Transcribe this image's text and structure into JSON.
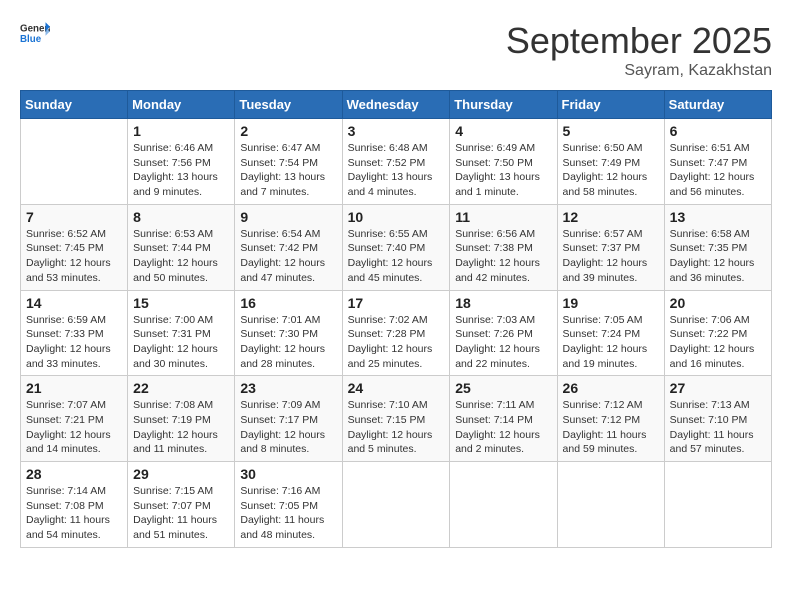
{
  "header": {
    "logo_general": "General",
    "logo_blue": "Blue",
    "month_title": "September 2025",
    "location": "Sayram, Kazakhstan"
  },
  "weekdays": [
    "Sunday",
    "Monday",
    "Tuesday",
    "Wednesday",
    "Thursday",
    "Friday",
    "Saturday"
  ],
  "weeks": [
    [
      {
        "day": "",
        "sunrise": "",
        "sunset": "",
        "daylight": ""
      },
      {
        "day": "1",
        "sunrise": "Sunrise: 6:46 AM",
        "sunset": "Sunset: 7:56 PM",
        "daylight": "Daylight: 13 hours and 9 minutes."
      },
      {
        "day": "2",
        "sunrise": "Sunrise: 6:47 AM",
        "sunset": "Sunset: 7:54 PM",
        "daylight": "Daylight: 13 hours and 7 minutes."
      },
      {
        "day": "3",
        "sunrise": "Sunrise: 6:48 AM",
        "sunset": "Sunset: 7:52 PM",
        "daylight": "Daylight: 13 hours and 4 minutes."
      },
      {
        "day": "4",
        "sunrise": "Sunrise: 6:49 AM",
        "sunset": "Sunset: 7:50 PM",
        "daylight": "Daylight: 13 hours and 1 minute."
      },
      {
        "day": "5",
        "sunrise": "Sunrise: 6:50 AM",
        "sunset": "Sunset: 7:49 PM",
        "daylight": "Daylight: 12 hours and 58 minutes."
      },
      {
        "day": "6",
        "sunrise": "Sunrise: 6:51 AM",
        "sunset": "Sunset: 7:47 PM",
        "daylight": "Daylight: 12 hours and 56 minutes."
      }
    ],
    [
      {
        "day": "7",
        "sunrise": "Sunrise: 6:52 AM",
        "sunset": "Sunset: 7:45 PM",
        "daylight": "Daylight: 12 hours and 53 minutes."
      },
      {
        "day": "8",
        "sunrise": "Sunrise: 6:53 AM",
        "sunset": "Sunset: 7:44 PM",
        "daylight": "Daylight: 12 hours and 50 minutes."
      },
      {
        "day": "9",
        "sunrise": "Sunrise: 6:54 AM",
        "sunset": "Sunset: 7:42 PM",
        "daylight": "Daylight: 12 hours and 47 minutes."
      },
      {
        "day": "10",
        "sunrise": "Sunrise: 6:55 AM",
        "sunset": "Sunset: 7:40 PM",
        "daylight": "Daylight: 12 hours and 45 minutes."
      },
      {
        "day": "11",
        "sunrise": "Sunrise: 6:56 AM",
        "sunset": "Sunset: 7:38 PM",
        "daylight": "Daylight: 12 hours and 42 minutes."
      },
      {
        "day": "12",
        "sunrise": "Sunrise: 6:57 AM",
        "sunset": "Sunset: 7:37 PM",
        "daylight": "Daylight: 12 hours and 39 minutes."
      },
      {
        "day": "13",
        "sunrise": "Sunrise: 6:58 AM",
        "sunset": "Sunset: 7:35 PM",
        "daylight": "Daylight: 12 hours and 36 minutes."
      }
    ],
    [
      {
        "day": "14",
        "sunrise": "Sunrise: 6:59 AM",
        "sunset": "Sunset: 7:33 PM",
        "daylight": "Daylight: 12 hours and 33 minutes."
      },
      {
        "day": "15",
        "sunrise": "Sunrise: 7:00 AM",
        "sunset": "Sunset: 7:31 PM",
        "daylight": "Daylight: 12 hours and 30 minutes."
      },
      {
        "day": "16",
        "sunrise": "Sunrise: 7:01 AM",
        "sunset": "Sunset: 7:30 PM",
        "daylight": "Daylight: 12 hours and 28 minutes."
      },
      {
        "day": "17",
        "sunrise": "Sunrise: 7:02 AM",
        "sunset": "Sunset: 7:28 PM",
        "daylight": "Daylight: 12 hours and 25 minutes."
      },
      {
        "day": "18",
        "sunrise": "Sunrise: 7:03 AM",
        "sunset": "Sunset: 7:26 PM",
        "daylight": "Daylight: 12 hours and 22 minutes."
      },
      {
        "day": "19",
        "sunrise": "Sunrise: 7:05 AM",
        "sunset": "Sunset: 7:24 PM",
        "daylight": "Daylight: 12 hours and 19 minutes."
      },
      {
        "day": "20",
        "sunrise": "Sunrise: 7:06 AM",
        "sunset": "Sunset: 7:22 PM",
        "daylight": "Daylight: 12 hours and 16 minutes."
      }
    ],
    [
      {
        "day": "21",
        "sunrise": "Sunrise: 7:07 AM",
        "sunset": "Sunset: 7:21 PM",
        "daylight": "Daylight: 12 hours and 14 minutes."
      },
      {
        "day": "22",
        "sunrise": "Sunrise: 7:08 AM",
        "sunset": "Sunset: 7:19 PM",
        "daylight": "Daylight: 12 hours and 11 minutes."
      },
      {
        "day": "23",
        "sunrise": "Sunrise: 7:09 AM",
        "sunset": "Sunset: 7:17 PM",
        "daylight": "Daylight: 12 hours and 8 minutes."
      },
      {
        "day": "24",
        "sunrise": "Sunrise: 7:10 AM",
        "sunset": "Sunset: 7:15 PM",
        "daylight": "Daylight: 12 hours and 5 minutes."
      },
      {
        "day": "25",
        "sunrise": "Sunrise: 7:11 AM",
        "sunset": "Sunset: 7:14 PM",
        "daylight": "Daylight: 12 hours and 2 minutes."
      },
      {
        "day": "26",
        "sunrise": "Sunrise: 7:12 AM",
        "sunset": "Sunset: 7:12 PM",
        "daylight": "Daylight: 11 hours and 59 minutes."
      },
      {
        "day": "27",
        "sunrise": "Sunrise: 7:13 AM",
        "sunset": "Sunset: 7:10 PM",
        "daylight": "Daylight: 11 hours and 57 minutes."
      }
    ],
    [
      {
        "day": "28",
        "sunrise": "Sunrise: 7:14 AM",
        "sunset": "Sunset: 7:08 PM",
        "daylight": "Daylight: 11 hours and 54 minutes."
      },
      {
        "day": "29",
        "sunrise": "Sunrise: 7:15 AM",
        "sunset": "Sunset: 7:07 PM",
        "daylight": "Daylight: 11 hours and 51 minutes."
      },
      {
        "day": "30",
        "sunrise": "Sunrise: 7:16 AM",
        "sunset": "Sunset: 7:05 PM",
        "daylight": "Daylight: 11 hours and 48 minutes."
      },
      {
        "day": "",
        "sunrise": "",
        "sunset": "",
        "daylight": ""
      },
      {
        "day": "",
        "sunrise": "",
        "sunset": "",
        "daylight": ""
      },
      {
        "day": "",
        "sunrise": "",
        "sunset": "",
        "daylight": ""
      },
      {
        "day": "",
        "sunrise": "",
        "sunset": "",
        "daylight": ""
      }
    ]
  ]
}
